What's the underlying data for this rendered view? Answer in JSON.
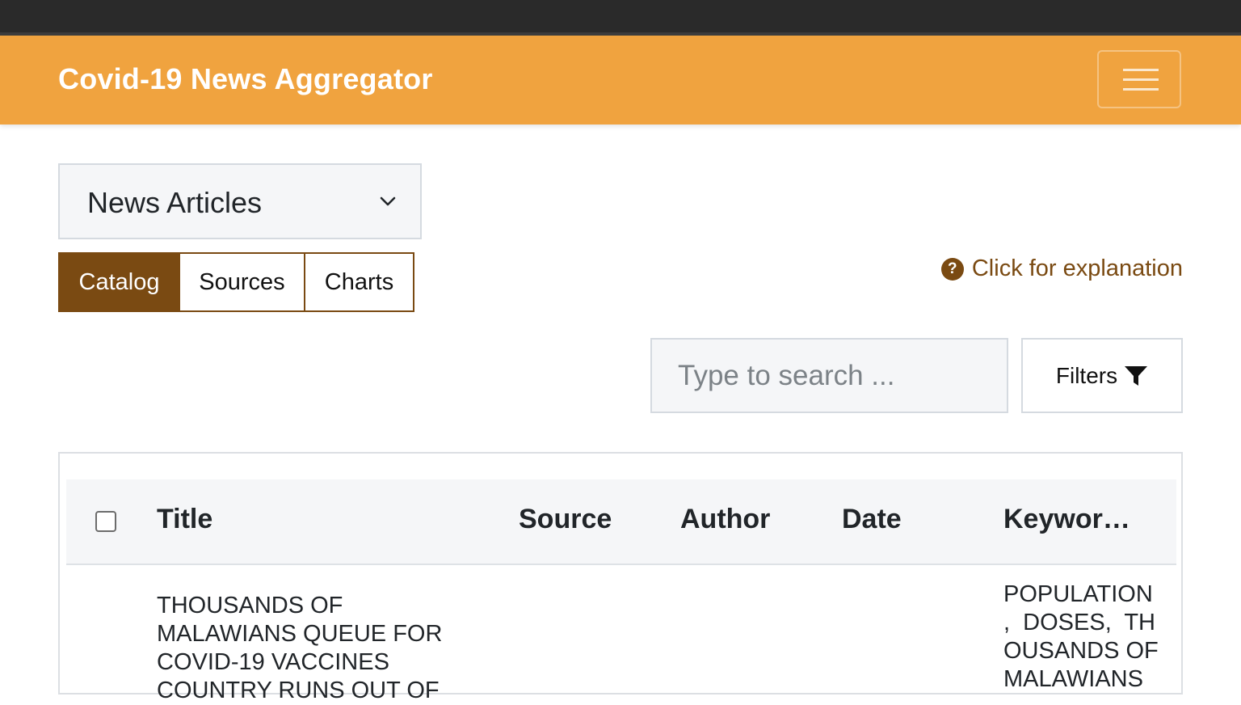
{
  "navbar": {
    "brand": "Covid-19 News Aggregator",
    "menu_icon": "hamburger-icon"
  },
  "dataset_select": {
    "selected": "News Articles",
    "icon": "chevron-down-icon"
  },
  "tabs": [
    {
      "label": "Catalog",
      "active": true
    },
    {
      "label": "Sources",
      "active": false
    },
    {
      "label": "Charts",
      "active": false
    }
  ],
  "explain": {
    "label": "Click for explanation",
    "icon": "question-circle-icon"
  },
  "search": {
    "placeholder": "Type to search ...",
    "value": ""
  },
  "filters": {
    "label": "Filters",
    "icon": "funnel-icon"
  },
  "table": {
    "columns": [
      "Title",
      "Source",
      "Author",
      "Date",
      "Keywor…"
    ],
    "rows": [
      {
        "title_lines": [
          "THOUSANDS OF",
          "MALAWIANS QUEUE FOR",
          "COVID-19 VACCINES",
          "COUNTRY RUNS OUT OF"
        ],
        "keyword_lines": [
          "POPULATION",
          ",  DOSES,  TH",
          "OUSANDS OF",
          "MALAWIANS"
        ]
      }
    ]
  },
  "colors": {
    "topbar": "#2a2a2a",
    "navbar": "#f0a33f",
    "accent": "#7a4a12"
  }
}
